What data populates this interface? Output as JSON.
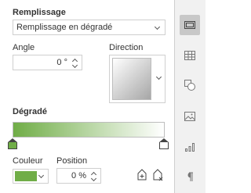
{
  "fill": {
    "label": "Remplissage",
    "type_value": "Remplissage en dégradé"
  },
  "angle": {
    "label": "Angle",
    "value": "0 °"
  },
  "direction": {
    "label": "Direction"
  },
  "gradient": {
    "label": "Dégradé",
    "stops": [
      {
        "color": "#70ad47",
        "position": 0
      },
      {
        "color": "#ffffff",
        "position": 100
      }
    ]
  },
  "stop_color": {
    "label": "Couleur",
    "value": "#70ad47"
  },
  "stop_position": {
    "label": "Position",
    "value": "0 %"
  },
  "stop_buttons": {
    "add_icon": "add-gradient-point-icon",
    "remove_icon": "remove-gradient-point-icon"
  },
  "right_bar": {
    "items": [
      {
        "name": "paragraph-settings",
        "icon": "pilcrow-icon",
        "active": false
      },
      {
        "name": "chart-settings",
        "icon": "chart-icon",
        "active": false
      },
      {
        "name": "image-settings",
        "icon": "image-icon",
        "active": false
      },
      {
        "name": "shape-settings",
        "icon": "shape-icon",
        "active": false
      },
      {
        "name": "table-settings",
        "icon": "table-icon",
        "active": false
      },
      {
        "name": "slide-settings",
        "icon": "slide-icon",
        "active": true
      }
    ]
  },
  "colors": {
    "accent_green": "#70ad47",
    "border": "#cfcfcf",
    "active_tab_bg": "#c8c8c8"
  }
}
